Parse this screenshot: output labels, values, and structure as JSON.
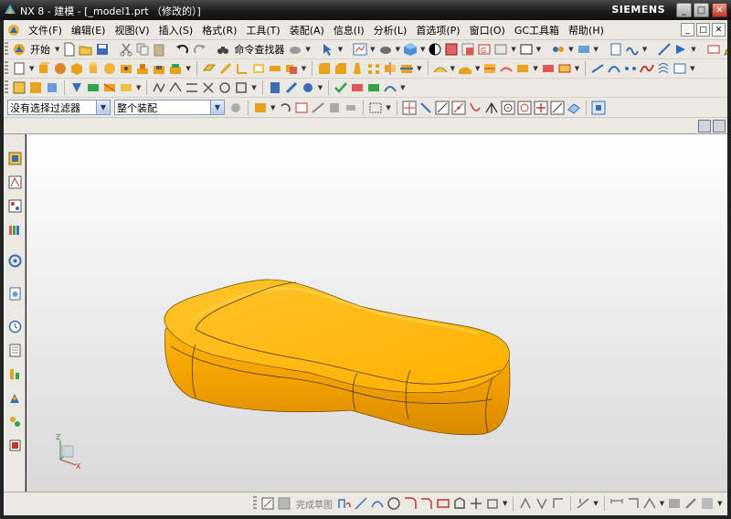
{
  "window": {
    "title": "NX 8 - 建模 - [_model1.prt （修改的）]",
    "brand": "SIEMENS",
    "controls": {
      "minimize": "_",
      "restore": "□",
      "close": "✕"
    }
  },
  "menubar": {
    "items": [
      {
        "label": "文件(F)"
      },
      {
        "label": "编辑(E)"
      },
      {
        "label": "视图(V)"
      },
      {
        "label": "插入(S)"
      },
      {
        "label": "格式(R)"
      },
      {
        "label": "工具(T)"
      },
      {
        "label": "装配(A)"
      },
      {
        "label": "信息(I)"
      },
      {
        "label": "分析(L)"
      },
      {
        "label": "首选项(P)"
      },
      {
        "label": "窗口(O)"
      },
      {
        "label": "GC工具箱"
      },
      {
        "label": "帮助(H)"
      }
    ],
    "sub_controls": [
      "_",
      "□",
      "✕"
    ]
  },
  "standard_toolbar": {
    "start_label": "开始",
    "command_finder_label": "命令查找器"
  },
  "selection_bar": {
    "filter_value": "没有选择过滤器",
    "scope_value": "整个装配"
  },
  "bottom_bar": {
    "finish_sketch_label": "完成草图"
  },
  "triad": {
    "z_label": "Z",
    "x_label": "X",
    "y_label": "Y"
  },
  "colors": {
    "part_fill": "#f5a800",
    "part_top": "#ffc21a",
    "part_shadow": "#d47f00",
    "edge_line": "#4a3a1a",
    "viewport_top": "#ffffff",
    "viewport_bottom": "#d9d9d9"
  }
}
